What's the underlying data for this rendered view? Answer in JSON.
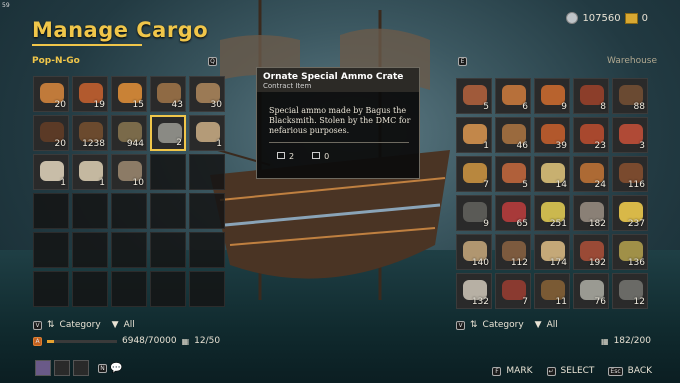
{
  "fps": "59",
  "title": "Manage Cargo",
  "currency": {
    "silver": "107560",
    "gold": "0"
  },
  "left_panel": {
    "name": "Pop-N-Go",
    "key": "Q",
    "sort_key": "V",
    "sort_label": "Category",
    "filter_label": "All",
    "capacity_key": "A",
    "weight": "6948/70000",
    "weight_fraction": 0.099,
    "slots_used": "12/50",
    "items": [
      {
        "qty": "20",
        "color": "#c07a3a",
        "tag": ""
      },
      {
        "qty": "19",
        "color": "#b25a2e",
        "tag": ""
      },
      {
        "qty": "15",
        "color": "#c98236",
        "tag": ""
      },
      {
        "qty": "43",
        "color": "#8f6a44",
        "tag": ""
      },
      {
        "qty": "30",
        "color": "#9b7a55",
        "tag": ""
      },
      {
        "qty": "20",
        "color": "#5b3a26",
        "tag": ""
      },
      {
        "qty": "1238",
        "color": "#6b4a2e",
        "tag": ""
      },
      {
        "qty": "944",
        "color": "#7a6a4a",
        "tag": ""
      },
      {
        "qty": "2",
        "color": "#8a8a84",
        "tag": "",
        "selected": true
      },
      {
        "qty": "1",
        "color": "#b49b78",
        "tag": ""
      },
      {
        "qty": "1",
        "color": "#c8bda8",
        "tag": ""
      },
      {
        "qty": "1",
        "color": "#c4b8a0",
        "tag": ""
      },
      {
        "qty": "10",
        "color": "#8c7b66",
        "tag": ""
      }
    ]
  },
  "tooltip": {
    "name": "Ornate Special Ammo Crate",
    "type": "Contract Item",
    "description": "Special ammo made by Bagus the Blacksmith. Stolen by the DMC for nefarious purposes.",
    "stat1": "2",
    "stat2": "0"
  },
  "right_panel": {
    "name": "Warehouse",
    "key": "E",
    "sort_key": "V",
    "sort_label": "Category",
    "filter_label": "All",
    "slots_used": "182/200",
    "items": [
      {
        "qty": "5",
        "color": "#a05a3a"
      },
      {
        "qty": "6",
        "color": "#b7703a"
      },
      {
        "qty": "9",
        "color": "#b8632e"
      },
      {
        "qty": "8",
        "color": "#8c3e2a"
      },
      {
        "qty": "88",
        "color": "#6a4a32"
      },
      {
        "qty": "1",
        "color": "#c2874a"
      },
      {
        "qty": "46",
        "color": "#9a6a3e"
      },
      {
        "qty": "39",
        "color": "#b2582c"
      },
      {
        "qty": "23",
        "color": "#a8482e"
      },
      {
        "qty": "3",
        "color": "#b04a36"
      },
      {
        "qty": "7",
        "color": "#b8873e"
      },
      {
        "qty": "5",
        "color": "#b0603a"
      },
      {
        "qty": "14",
        "color": "#c8b070"
      },
      {
        "qty": "24",
        "color": "#ad6a34"
      },
      {
        "qty": "116",
        "color": "#7a4a2e"
      },
      {
        "qty": "9",
        "color": "#5a5a56"
      },
      {
        "qty": "65",
        "color": "#a83a3a"
      },
      {
        "qty": "251",
        "color": "#cbb84e"
      },
      {
        "qty": "182",
        "color": "#8a8076"
      },
      {
        "qty": "237",
        "color": "#d8b848"
      },
      {
        "qty": "140",
        "color": "#b09670"
      },
      {
        "qty": "112",
        "color": "#7c5a3e"
      },
      {
        "qty": "174",
        "color": "#c4a878"
      },
      {
        "qty": "192",
        "color": "#9a4a36"
      },
      {
        "qty": "136",
        "color": "#a09048"
      },
      {
        "qty": "132",
        "color": "#b7b0a4"
      },
      {
        "qty": "7",
        "color": "#8a3a30"
      },
      {
        "qty": "11",
        "color": "#7a5a34"
      },
      {
        "qty": "76",
        "color": "#9a9a92"
      },
      {
        "qty": "12",
        "color": "#6a6a66"
      }
    ]
  },
  "hints": {
    "mark_key": "F",
    "mark": "MARK",
    "select_key": "↵",
    "select": "SELECT",
    "back_key": "Esc",
    "back": "BACK"
  },
  "bottom_left": {
    "key": "N"
  }
}
